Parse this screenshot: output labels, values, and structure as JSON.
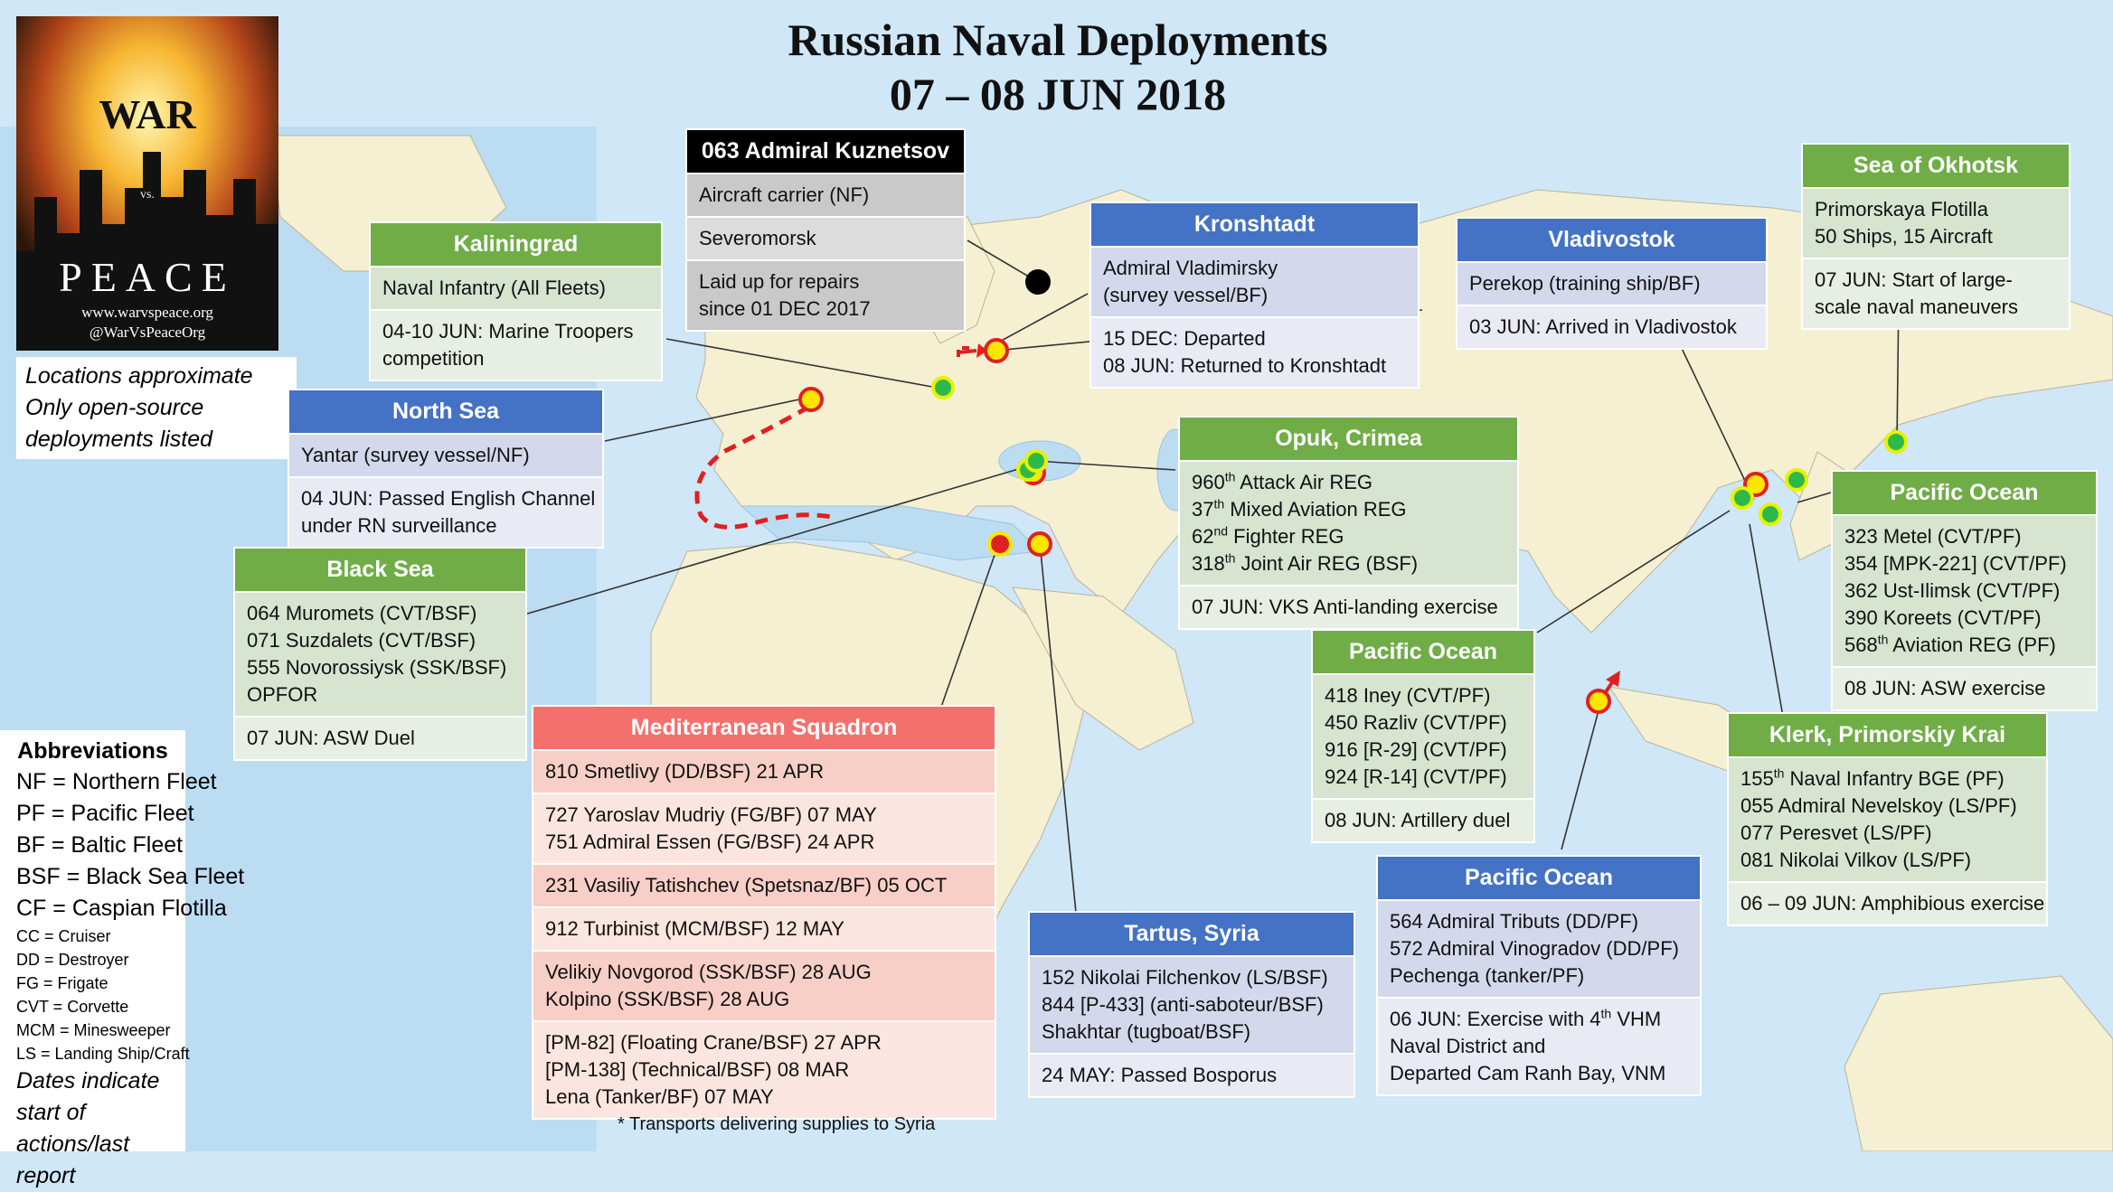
{
  "title": {
    "line1": "Russian Naval Deployments",
    "line2": "07 – 08 JUN 2018"
  },
  "logo": {
    "word_top": "WAR",
    "word_mid": "vs.",
    "word_bottom": "PEACE",
    "url": "www.warvspeace.org",
    "handle": "@WarVsPeaceOrg"
  },
  "notes": {
    "line1": "Locations approximate",
    "line2": "Only open-source",
    "line3": "deployments listed"
  },
  "abbreviations": {
    "heading": "Abbreviations",
    "fleets": [
      "NF = Northern Fleet",
      "PF = Pacific Fleet",
      "BF = Baltic Fleet",
      "BSF = Black Sea Fleet",
      "CF = Caspian Flotilla"
    ],
    "types": [
      "CC = Cruiser",
      "DD = Destroyer",
      "FG = Frigate",
      "CVT = Corvette",
      "MCM = Minesweeper",
      "LS = Landing Ship/Craft"
    ],
    "dates_note_line1": "Dates indicate start of",
    "dates_note_line2": "actions/last report"
  },
  "footnote": "* Transports delivering supplies to Syria",
  "boxes": {
    "kuznetsov": {
      "header": "063 Admiral Kuznetsov",
      "rows": [
        "Aircraft carrier (NF)",
        "Severomorsk",
        "Laid up for repairs",
        "since 01 DEC 2017"
      ]
    },
    "kaliningrad": {
      "header": "Kaliningrad",
      "rows": [
        "Naval Infantry (All Fleets)",
        "04-10 JUN: Marine Troopers",
        "competition"
      ]
    },
    "north_sea": {
      "header": "North Sea",
      "rows": [
        "Yantar (survey vessel/NF)",
        "04 JUN: Passed English Channel",
        "under RN surveillance"
      ]
    },
    "kronshtadt": {
      "header": "Kronshtadt",
      "rows": [
        "Admiral Vladimirsky",
        "(survey vessel/BF)",
        "15 DEC: Departed",
        "08 JUN: Returned to Kronshtadt"
      ]
    },
    "vladivostok": {
      "header": "Vladivostok",
      "rows": [
        "Perekop (training ship/BF)",
        "03 JUN: Arrived in Vladivostok"
      ]
    },
    "okhotsk": {
      "header": "Sea of Okhotsk",
      "rows": [
        "Primorskaya Flotilla",
        "50 Ships, 15 Aircraft",
        "07 JUN: Start of large-",
        "scale naval maneuvers"
      ]
    },
    "opuk": {
      "header": "Opuk, Crimea",
      "rows": [
        "960",
        "th",
        " Attack Air REG",
        "37",
        "th",
        " Mixed Aviation REG",
        "62",
        "nd",
        " Fighter REG",
        "318",
        "th",
        " Joint Air REG (BSF)",
        "07 JUN: VKS Anti-landing exercise"
      ]
    },
    "black_sea": {
      "header": "Black Sea",
      "rows": [
        "064 Muromets (CVT/BSF)",
        "071 Suzdalets (CVT/BSF)",
        "555 Novorossiysk (SSK/BSF)",
        "OPFOR",
        "07 JUN: ASW Duel"
      ]
    },
    "pacific_kuril": {
      "header": "Pacific Ocean",
      "rows": [
        "323 Metel (CVT/PF)",
        "354 [MPK-221] (CVT/PF)",
        "362 Ust-Ilimsk (CVT/PF)",
        "390 Koreets (CVT/PF)",
        "568",
        "th",
        " Aviation REG (PF)",
        "08 JUN: ASW exercise"
      ]
    },
    "pacific_artillery": {
      "header": "Pacific Ocean",
      "rows": [
        "418 Iney (CVT/PF)",
        "450 Razliv (CVT/PF)",
        "916 [R-29] (CVT/PF)",
        "924 [R-14] (CVT/PF)",
        "08 JUN: Artillery duel"
      ]
    },
    "med": {
      "header": "Mediterranean Squadron",
      "rows": [
        "810 Smetlivy (DD/BSF) 21 APR",
        "727 Yaroslav Mudriy (FG/BF) 07 MAY",
        "751 Admiral Essen (FG/BSF) 24 APR",
        "231 Vasiliy Tatishchev (Spetsnaz/BF) 05 OCT",
        "912 Turbinist (MCM/BSF) 12 MAY",
        "Velikiy Novgorod (SSK/BSF) 28 AUG",
        "Kolpino (SSK/BSF) 28 AUG",
        "[PM-82] (Floating Crane/BSF) 27 APR",
        "[PM-138] (Technical/BSF) 08 MAR",
        "Lena (Tanker/BF) 07 MAY"
      ]
    },
    "tartus": {
      "header": "Tartus, Syria",
      "rows": [
        "152 Nikolai Filchenkov (LS/BSF)",
        "844 [P-433] (anti-saboteur/BSF)",
        "Shakhtar (tugboat/BSF)",
        "24 MAY: Passed Bosporus"
      ]
    },
    "pacific_vnm": {
      "header": "Pacific Ocean",
      "rows": [
        "564 Admiral Tributs (DD/PF)",
        "572 Admiral Vinogradov (DD/PF)",
        "Pechenga (tanker/PF)",
        "06 JUN: Exercise with 4",
        "th",
        " VHM",
        "Naval District and",
        "Departed Cam Ranh Bay, VNM"
      ]
    },
    "klerk": {
      "header": "Klerk, Primorskiy Krai",
      "rows": [
        "155",
        "th",
        " Naval Infantry BGE (PF)",
        "055 Admiral Nevelskoy (LS/PF)",
        "077 Peresvet (LS/PF)",
        "081 Nikolai Vilkov (LS/PF)",
        "06 – 09 JUN: Amphibious exercise"
      ]
    }
  },
  "colors": {
    "ocean": "#cfe7f7",
    "land": "#f5f0d2",
    "green_header": "#70ad47",
    "blue_header": "#4472c4",
    "red_header": "#f4706c",
    "black_header": "#000000",
    "route": "#e02020"
  }
}
